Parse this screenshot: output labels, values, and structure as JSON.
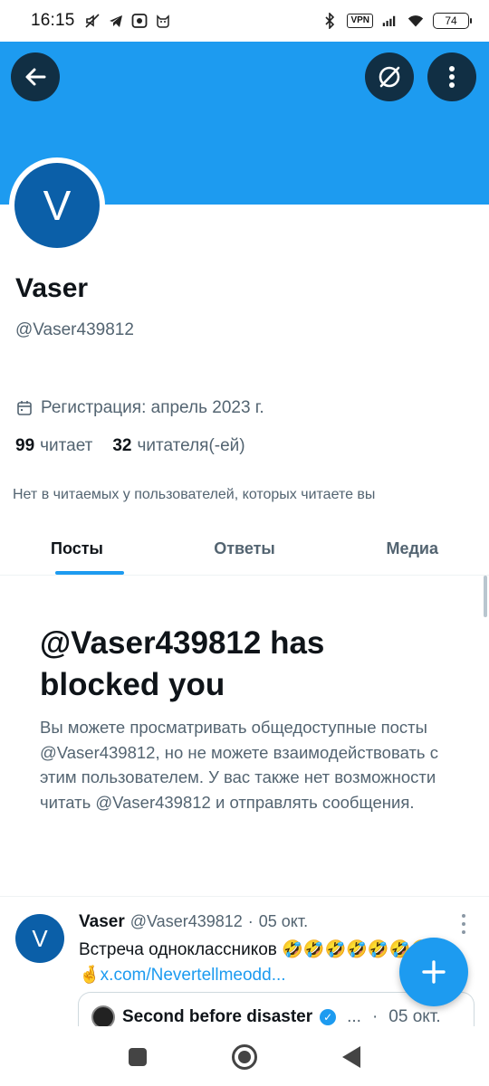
{
  "status_bar": {
    "time": "16:15",
    "vpn_label": "VPN",
    "battery": "74"
  },
  "colors": {
    "accent": "#1d9bf0",
    "avatar_bg": "#0b5fa8",
    "secondary_text": "#536471"
  },
  "header": {
    "back_icon": "arrow-left-icon",
    "nosync_icon": "circle-slash-icon",
    "more_icon": "vertical-dots-icon"
  },
  "profile": {
    "avatar_letter": "V",
    "display_name": "Vaser",
    "handle": "@Vaser439812",
    "joined": "Регистрация: апрель 2023 г.",
    "following_count": "99",
    "following_label": "читает",
    "followers_count": "32",
    "followers_label": "читателя(-ей)",
    "no_common": "Нет в читаемых у пользователей, которых читаете вы"
  },
  "tabs": [
    {
      "label": "Посты",
      "active": true
    },
    {
      "label": "Ответы",
      "active": false
    },
    {
      "label": "Медиа",
      "active": false
    }
  ],
  "blocked": {
    "title": "@Vaser439812 has blocked you",
    "text": "Вы можете просматривать общедоступные посты @Vaser439812, но не можете взаимодействовать с этим пользователем. У вас также нет возможности читать @Vaser439812 и отправлять сообщения."
  },
  "post": {
    "avatar_letter": "V",
    "name": "Vaser",
    "handle": "@Vaser439812",
    "separator": "·",
    "date": "05 окт.",
    "text": "Встреча одноклассников 🤣🤣🤣🤣🤣🤣🤣",
    "emoji_prefix": "🤞",
    "link": "x.com/Nevertellmeodd...",
    "quote": {
      "name": "Second before disaster",
      "ellipsis": "...",
      "separator": "·",
      "date": "05 окт."
    }
  },
  "fab_icon": "plus-icon"
}
